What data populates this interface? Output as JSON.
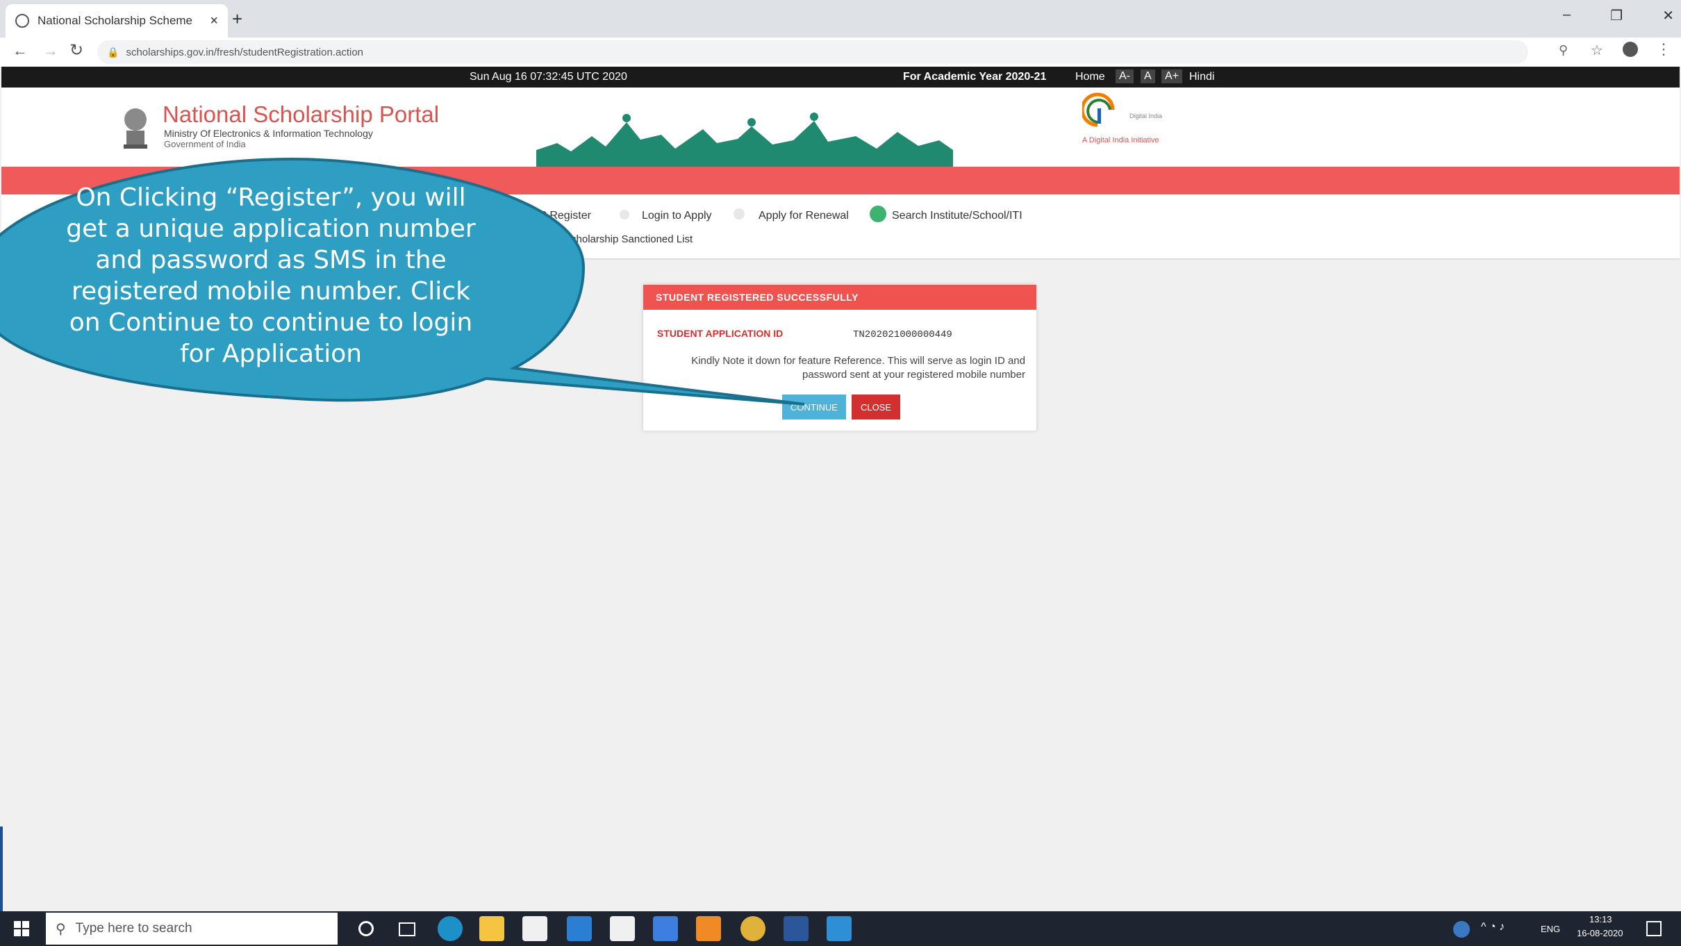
{
  "browser": {
    "tab_title": "National Scholarship Scheme",
    "tab_close": "×",
    "new_tab": "+",
    "url": "scholarships.gov.in/fresh/studentRegistration.action",
    "window_controls": [
      "–",
      "❐",
      "✕"
    ]
  },
  "topstrip": {
    "datetime": "Sun Aug 16 07:32:45 UTC 2020",
    "academic_year": "For Academic Year 2020-21",
    "home": "Home",
    "font_small": "A-",
    "font_normal": "A",
    "font_large": "A+",
    "language": "Hindi"
  },
  "header": {
    "title": "National Scholarship Portal",
    "ministry": "Ministry Of Electronics & Information Technology",
    "government": "Government of India",
    "digital_india_tagline": "A Digital India Initiative",
    "digital_india_label": "Digital India"
  },
  "nav": {
    "register": "New? Register",
    "login": "Login to Apply",
    "renewal": "Apply for Renewal",
    "search_institute": "Search Institute/School/ITI",
    "sanctioned_list": "Scholarship Sanctioned List"
  },
  "modal": {
    "title": "STUDENT REGISTERED SUCCESSFULLY",
    "app_id_label": "STUDENT APPLICATION ID",
    "app_id_value": "TN202021000000449",
    "note": "Kindly Note it down for feature Reference. This will serve as login ID and password sent at your registered mobile number",
    "continue_label": "CONTINUE",
    "close_label": "CLOSE"
  },
  "callout": {
    "text": "On Clicking “Register”, you will get a unique application number and password as SMS in the registered mobile number. Click on Continue to continue to login for Application"
  },
  "taskbar": {
    "search_placeholder": "Type here to search",
    "language": "ENG",
    "time": "13:13",
    "date": "16-08-2020"
  },
  "colors": {
    "red_band": "#f05a5a",
    "callout": "#2e9ec2",
    "continue_button": "#4fb3d9",
    "close_button": "#d32f2f"
  }
}
